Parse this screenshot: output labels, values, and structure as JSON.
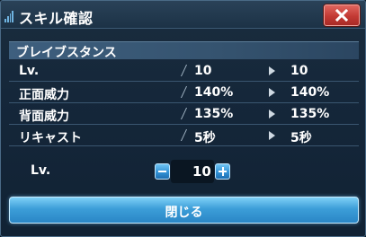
{
  "dialog": {
    "title": "スキル確認",
    "close_icon": "close-x-icon"
  },
  "skill": {
    "name": "ブレイブスタンス",
    "rows": [
      {
        "label": "Lv.",
        "current": "10",
        "next": "10"
      },
      {
        "label": "正面威力",
        "current": "140%",
        "next": "140%"
      },
      {
        "label": "背面威力",
        "current": "135%",
        "next": "135%"
      },
      {
        "label": "リキャスト",
        "current": "5秒",
        "next": "5秒"
      }
    ]
  },
  "level_selector": {
    "label": "Lv.",
    "value": "10",
    "decrement_icon": "minus-icon",
    "increment_icon": "plus-icon"
  },
  "footer": {
    "close_label": "閉じる"
  },
  "colors": {
    "accent": "#3c9ed8",
    "close_button": "#c33a34",
    "panel_header": "#3e5f7e"
  }
}
